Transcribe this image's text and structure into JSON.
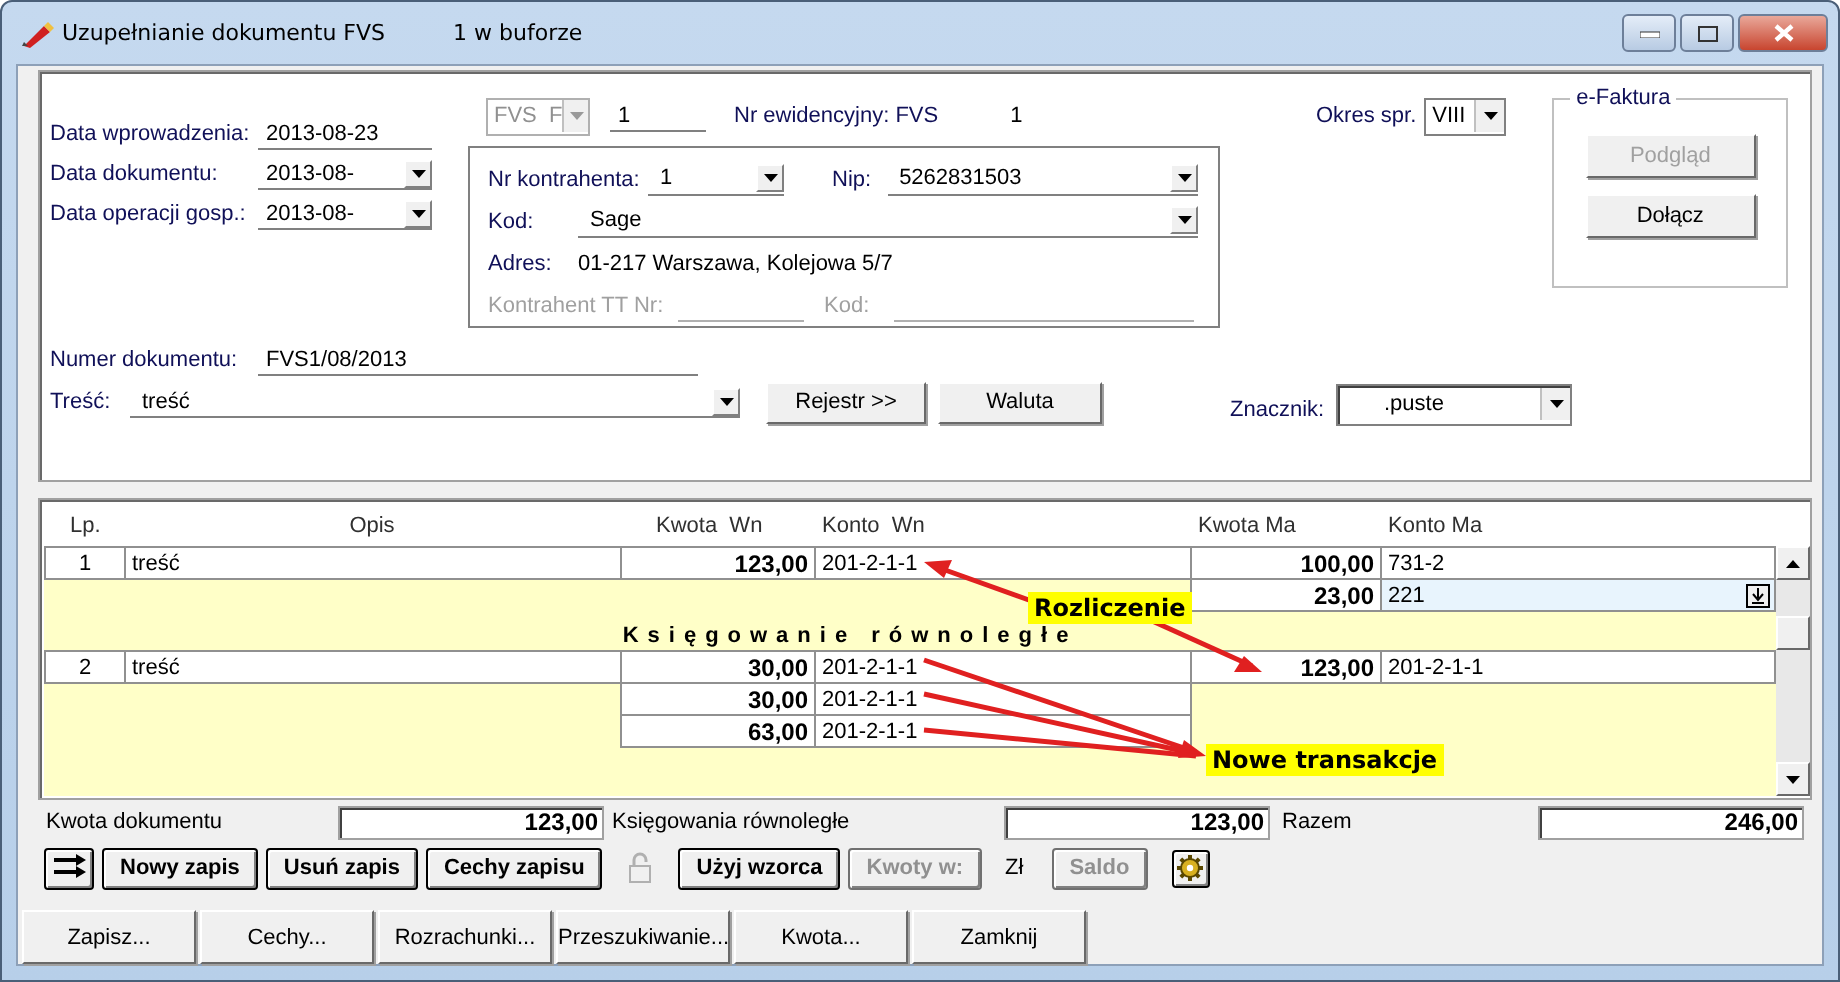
{
  "window": {
    "title": "Uzupełnianie dokumentu FVS",
    "subtitle": "1 w buforze"
  },
  "header": {
    "dates": [
      {
        "label": "Data wprowadzenia:",
        "value": "2013-08-23",
        "dropdown": false
      },
      {
        "label": "Data dokumentu:",
        "value": "2013-08-",
        "dropdown": true
      },
      {
        "label": "Data operacji gosp.:",
        "value": "2013-08-",
        "dropdown": true
      }
    ],
    "doc_type": {
      "value": "FVS  F",
      "disabled": true
    },
    "doc_no": "1",
    "registry": {
      "label": "Nr ewidencyjny: FVS",
      "number": "1"
    },
    "period": {
      "label": "Okres spr.",
      "value": "VIII"
    },
    "contractor": {
      "nr_label": "Nr kontrahenta:",
      "nr": "1",
      "nip_label": "Nip:",
      "nip": "5262831503",
      "kod_label": "Kod:",
      "kod": "Sage",
      "adres_label": "Adres:",
      "adres": "01-217 Warszawa, Kolejowa 5/7",
      "tt_label": "Kontrahent TT Nr:",
      "tt_kod_label": "Kod:",
      "tt_disabled": true
    },
    "efaktura": {
      "title": "e-Faktura",
      "buttons": [
        {
          "label": "Podgląd",
          "disabled": true
        },
        {
          "label": "Dołącz",
          "disabled": false
        }
      ]
    },
    "number": {
      "label": "Numer dokumentu:",
      "value": "FVS1/08/2013"
    },
    "content": {
      "label": "Treść:",
      "value": "treść"
    },
    "actions": [
      {
        "label": "Rejestr >>"
      },
      {
        "label": "Waluta"
      }
    ],
    "marker": {
      "label": "Znacznik:",
      "value": ".puste"
    }
  },
  "ledger": {
    "columns": [
      "Lp.",
      "Opis",
      "Kwota  Wn",
      "Konto  Wn",
      "Kwota Ma",
      "Konto Ma"
    ],
    "lines": [
      {
        "kind": "entry",
        "lp": "1",
        "opis": "treść",
        "kwota_wn": "123,00",
        "konto_wn": "201-2-1-1",
        "kwota_ma": "100,00",
        "konto_ma": "731-2",
        "selected": false
      },
      {
        "kind": "ma",
        "kwota_ma": "23,00",
        "konto_ma": "221",
        "selected": true
      },
      {
        "kind": "section",
        "label": "Księgowanie równoległe",
        "selected": false
      },
      {
        "kind": "entry",
        "lp": "2",
        "opis": "treść",
        "kwota_wn": "30,00",
        "konto_wn": "201-2-1-1",
        "kwota_ma": "123,00",
        "konto_ma": "201-2-1-1",
        "selected": false
      },
      {
        "kind": "wn",
        "kwota_wn": "30,00",
        "konto_wn": "201-2-1-1",
        "selected": false
      },
      {
        "kind": "wn",
        "kwota_wn": "63,00",
        "konto_wn": "201-2-1-1",
        "selected": false
      }
    ],
    "annotations": [
      {
        "label": "Rozliczenie"
      },
      {
        "label": "Nowe transakcje"
      }
    ]
  },
  "totals": [
    {
      "label": "Kwota dokumentu",
      "value": "123,00"
    },
    {
      "label": "Księgowania równoległe",
      "value": "123,00"
    },
    {
      "label": "Razem",
      "value": "246,00"
    }
  ],
  "toolbar": [
    {
      "kind": "swap",
      "disabled": false
    },
    {
      "kind": "button",
      "label": "Nowy zapis",
      "disabled": false
    },
    {
      "kind": "button",
      "label": "Usuń zapis",
      "disabled": false
    },
    {
      "kind": "button",
      "label": "Cechy zapisu",
      "disabled": false
    },
    {
      "kind": "lock",
      "disabled": true
    },
    {
      "kind": "button",
      "label": "Użyj wzorca",
      "disabled": false
    },
    {
      "kind": "button",
      "label": "Kwoty w:",
      "disabled": true
    },
    {
      "kind": "text",
      "label": "Zł"
    },
    {
      "kind": "button",
      "label": "Saldo",
      "disabled": true
    },
    {
      "kind": "gear",
      "disabled": false
    }
  ],
  "footer_buttons": [
    "Zapisz...",
    "Cechy...",
    "Rozrachunki...",
    "Przeszukiwanie...",
    "Kwota...",
    "Zamknij"
  ]
}
